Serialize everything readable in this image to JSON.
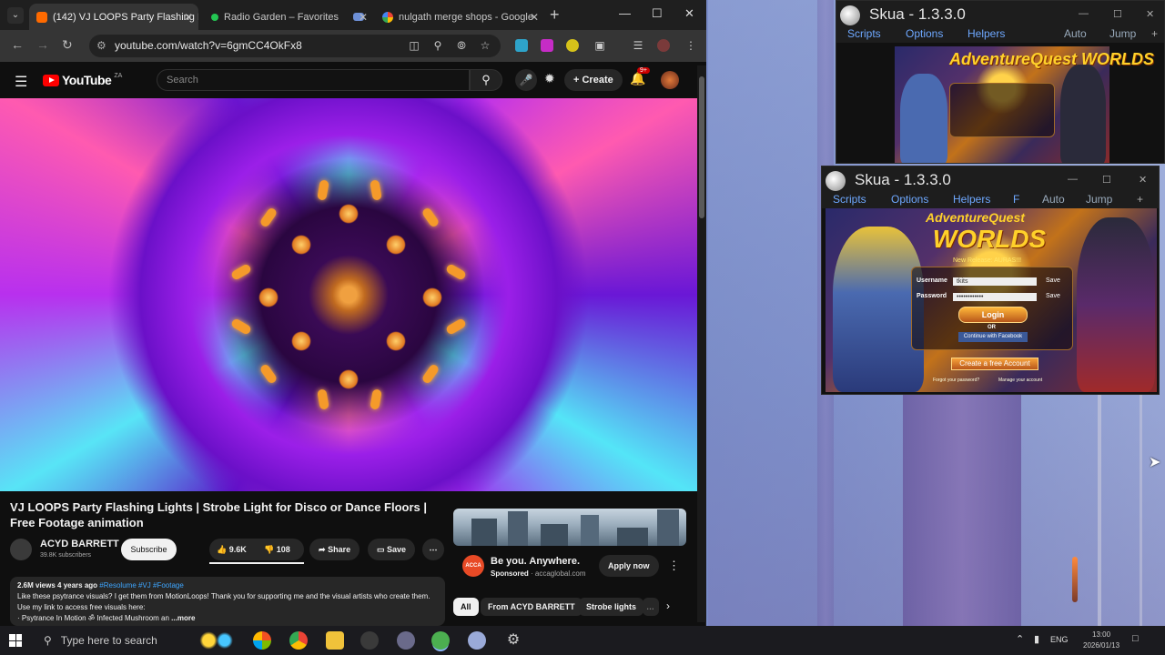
{
  "browser": {
    "tabs": [
      {
        "label": "(142) VJ LOOPS Party Flashing L",
        "color": "#ff6a00"
      },
      {
        "label": "Radio Garden – Favorites",
        "color": "#23c552"
      },
      {
        "label": "nulgath merge shops - Google",
        "color": "#4285f4"
      }
    ],
    "url": "youtube.com/watch?v=6gmCC4OkFx8"
  },
  "youtube": {
    "logo": "YouTube",
    "region": "ZA",
    "search_placeholder": "Search",
    "create_label": "Create",
    "notifications": "9+",
    "video_title": "VJ LOOPS Party Flashing Lights | Strobe Light for Disco or Dance Floors | Free Footage animation",
    "channel_name": "ACYD BARRETT",
    "channel_subs": "39.8K subscribers",
    "subscribe_label": "Subscribe",
    "likes": "9.6K",
    "dislikes": "108",
    "share_label": "Share",
    "save_label": "Save",
    "desc_meta": "2.6M views  4 years ago",
    "desc_tags": "#Resolume #VJ #Footage",
    "desc_text": "Like these psytrance visuals? I get them from MotionLoops! Thank you for supporting me and the visual artists who create them. Use my link to access free visuals here:",
    "desc_line3": "· Psytrance In Motion ॐ Infected Mushroom an",
    "desc_more": "...more",
    "ad": {
      "logo_text": "ACCA",
      "title": "Be you. Anywhere.",
      "sponsored": "Sponsored",
      "domain": "· accaglobal.com",
      "apply_label": "Apply now"
    },
    "chips": [
      "All",
      "From ACYD BARRETT",
      "Strobe lights"
    ]
  },
  "skua_back": {
    "title": "Skua - 1.3.3.0",
    "menu": [
      "Scripts",
      "Options",
      "Helpers"
    ],
    "right_menu": [
      "Auto",
      "Jump"
    ],
    "game_logo": "AdventureQuest WORLDS"
  },
  "skua_front": {
    "title": "Skua - 1.3.3.0",
    "menu": [
      "Scripts",
      "Options",
      "Helpers",
      "F"
    ],
    "right_menu": [
      "Auto",
      "Jump"
    ],
    "game_logo_top": "AdventureQuest",
    "game_logo_main": "WORLDS",
    "release": "New Release: AURAS!!!",
    "username_label": "Username",
    "username_value": "tkits",
    "password_label": "Password",
    "password_value": "••••••••••••",
    "save_label": "Save",
    "login_label": "Login",
    "or_label": "OR",
    "facebook_label": "Continue with Facebook",
    "create_account_label": "Create a free Account",
    "footer_left": "Forgot your password?",
    "footer_right": "Manage your account"
  },
  "taskbar": {
    "search_placeholder": "Type here to search",
    "lang": "ENG",
    "time": "13:00",
    "date": "2026/01/13"
  }
}
